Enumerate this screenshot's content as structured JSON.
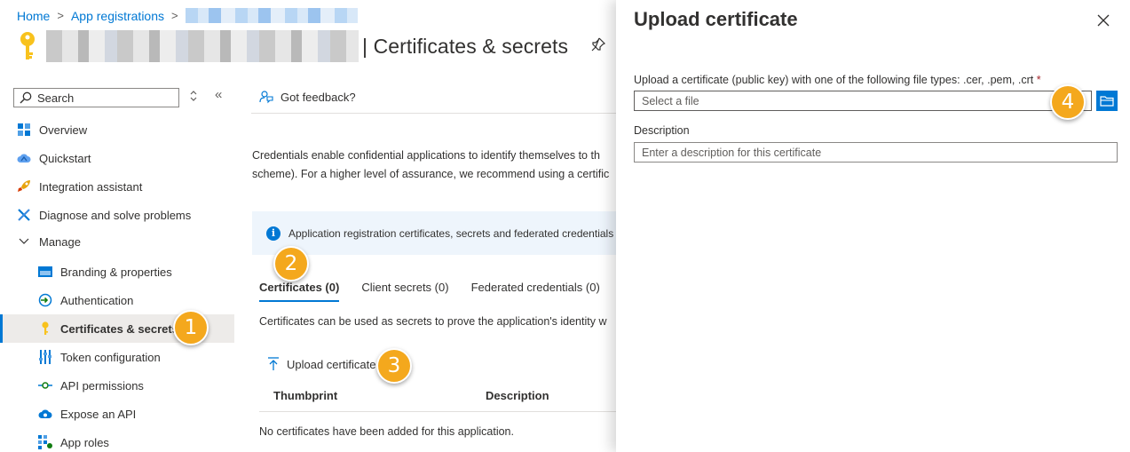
{
  "breadcrumb": {
    "home": "Home",
    "app_registrations": "App registrations",
    "sep": ">"
  },
  "header": {
    "title": "| Certificates & secrets"
  },
  "sidebar": {
    "search_placeholder": "Search",
    "collapse_label": "«",
    "sort_label": "⬦",
    "items": [
      {
        "label": "Overview"
      },
      {
        "label": "Quickstart"
      },
      {
        "label": "Integration assistant"
      },
      {
        "label": "Diagnose and solve problems"
      },
      {
        "label": "Manage"
      },
      {
        "label": "Branding & properties"
      },
      {
        "label": "Authentication"
      },
      {
        "label": "Certificates & secrets"
      },
      {
        "label": "Token configuration"
      },
      {
        "label": "API permissions"
      },
      {
        "label": "Expose an API"
      },
      {
        "label": "App roles"
      }
    ]
  },
  "main": {
    "feedback_label": "Got feedback?",
    "description_line1": "Credentials enable confidential applications to identify themselves to th",
    "description_line2": "scheme). For a higher level of assurance, we recommend using a certific",
    "info_text": "Application registration certificates, secrets and federated credentials c",
    "tabs": [
      {
        "label": "Certificates (0)"
      },
      {
        "label": "Client secrets (0)"
      },
      {
        "label": "Federated credentials (0)"
      }
    ],
    "tab_description": "Certificates can be used as secrets to prove the application's identity w",
    "upload_label": "Upload certificate",
    "table": {
      "columns": [
        "Thumbprint",
        "Description"
      ],
      "empty_message": "No certificates have been added for this application."
    }
  },
  "panel": {
    "title": "Upload certificate",
    "file_label": "Upload a certificate (public key) with one of the following file types: .cer, .pem, .crt",
    "required_marker": "*",
    "file_placeholder": "Select a file",
    "description_label": "Description",
    "description_placeholder": "Enter a description for this certificate"
  },
  "callouts": [
    "1",
    "2",
    "3",
    "4"
  ],
  "colors": {
    "accent": "#0078d4",
    "callout": "#f4a81d",
    "active_bg": "#edebe9",
    "info_bg": "#eef5fc"
  }
}
